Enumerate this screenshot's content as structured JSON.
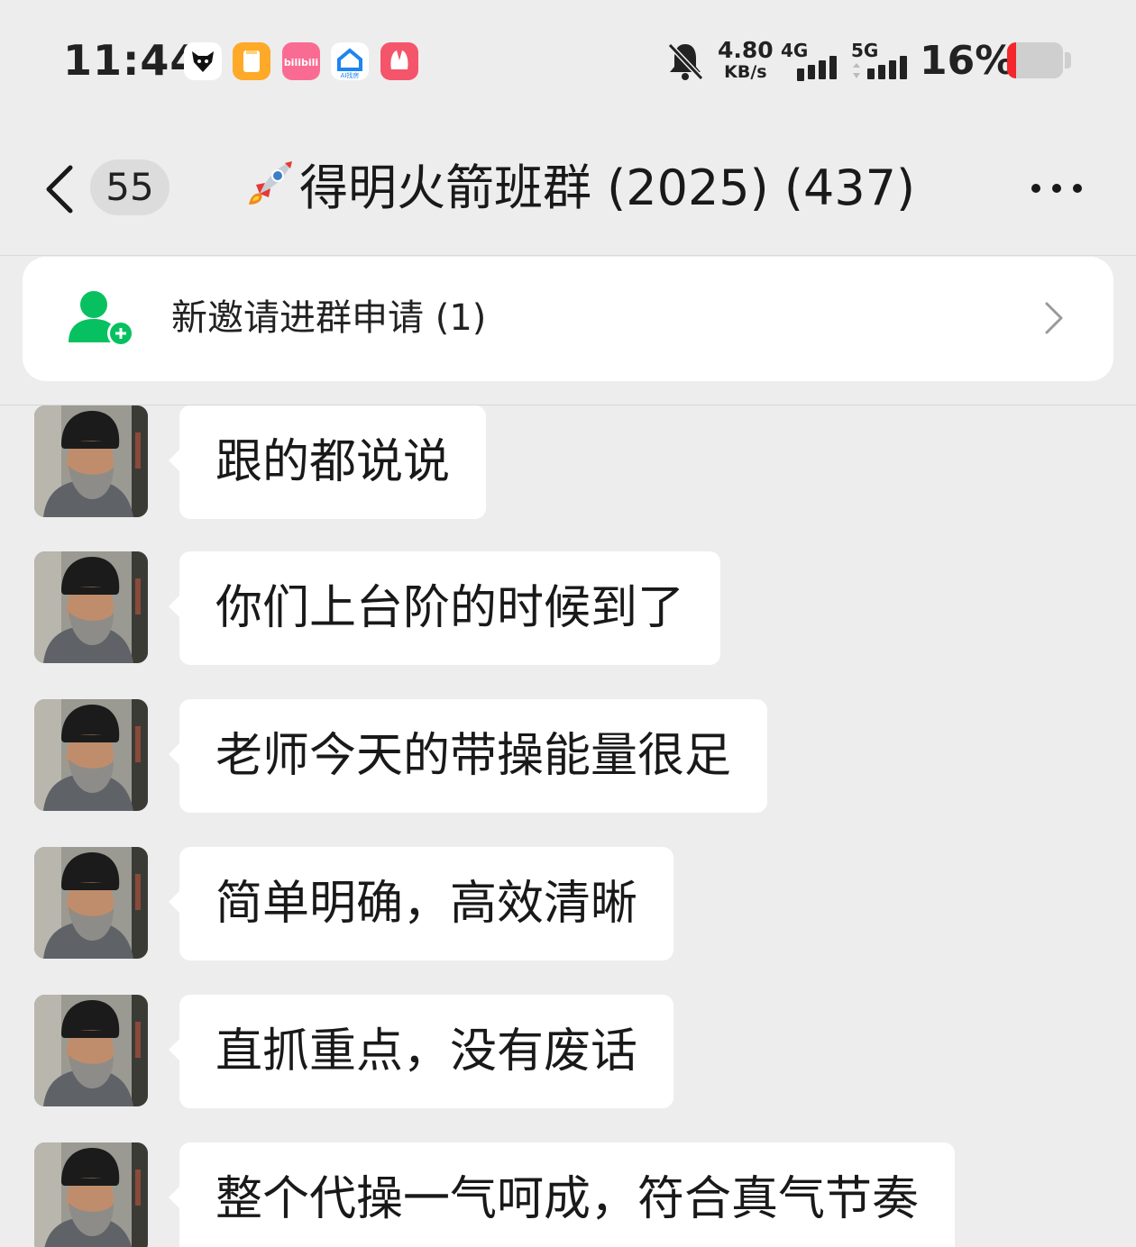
{
  "status_bar": {
    "time": "11:44",
    "app_icons": [
      {
        "name": "fox-app-icon",
        "color": "#ffffff"
      },
      {
        "name": "note-app-icon",
        "color": "#ffa928"
      },
      {
        "name": "bilibili-icon",
        "color": "#fa6b93",
        "text": "bilibili"
      },
      {
        "name": "ai-app-icon",
        "color": "#1e84f0",
        "text": "AI找房"
      },
      {
        "name": "xiaohongshu-icon",
        "color": "#f4556a"
      }
    ],
    "net_speed_value": "4.80",
    "net_speed_unit": "KB/s",
    "signal_1_label": "4G",
    "signal_2_label": "5G",
    "battery_percent": "16%",
    "battery_level": 0.16,
    "battery_color": "#f4262c"
  },
  "header": {
    "unread_count": "55",
    "title": "得明火箭班群 (2025) (437)"
  },
  "notice": {
    "text": "新邀请进群申请 (1)",
    "icon_color": "#07c160"
  },
  "messages": [
    {
      "text": "跟的都说说"
    },
    {
      "text": "你们上台阶的时候到了"
    },
    {
      "text": "老师今天的带操能量很足"
    },
    {
      "text": "简单明确，高效清晰"
    },
    {
      "text": "直抓重点，没有废话"
    },
    {
      "text": "整个代操一气呵成，符合真气节奏"
    }
  ]
}
